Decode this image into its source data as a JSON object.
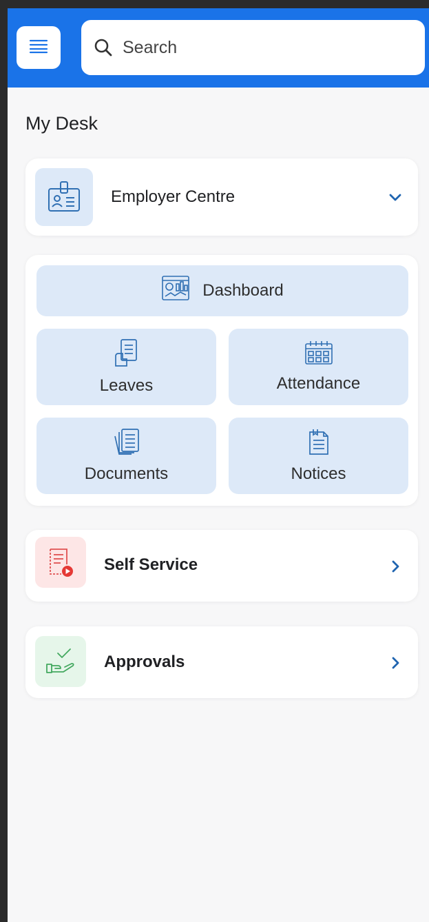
{
  "search": {
    "placeholder": "Search"
  },
  "page": {
    "title": "My Desk"
  },
  "employer_centre": {
    "label": "Employer Centre"
  },
  "tiles": {
    "dashboard": "Dashboard",
    "leaves": "Leaves",
    "attendance": "Attendance",
    "documents": "Documents",
    "notices": "Notices"
  },
  "self_service": {
    "label": "Self Service"
  },
  "approvals": {
    "label": "Approvals"
  },
  "colors": {
    "header": "#1a73e8",
    "tile_bg": "#dde9f8",
    "icon_blue": "#2f6fb3",
    "self_service_bg": "#fde6e6",
    "approvals_bg": "#e6f6ea"
  },
  "icons": {
    "menu": "hamburger-icon",
    "search": "search-icon",
    "employer_centre": "id-badge-icon",
    "expand": "chevron-down-icon",
    "dashboard": "dashboard-chart-icon",
    "leaves": "leave-document-icon",
    "attendance": "calendar-icon",
    "documents": "documents-stack-icon",
    "notices": "notice-clipboard-icon",
    "self_service": "self-service-icon",
    "approvals": "approval-hand-icon",
    "navigate": "chevron-right-icon"
  }
}
